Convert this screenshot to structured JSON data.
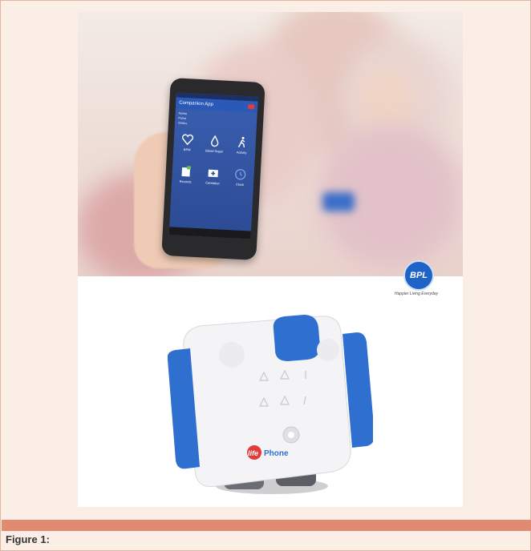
{
  "figure": {
    "caption": "Figure 1:"
  },
  "phone_app": {
    "title": "Companion App",
    "vitals": [
      "Name",
      "Pulse",
      "Status"
    ],
    "tiles_row1": [
      "BPM",
      "Blood Sugar",
      "Activity"
    ],
    "tiles_row2": [
      "Records",
      "Caretaker",
      "Clock"
    ]
  },
  "brand": {
    "logo": "BPL",
    "tagline": "Happier Living Everyday"
  },
  "device": {
    "brand_text_1": "life",
    "brand_text_2": "Phone"
  },
  "colors": {
    "frame_bg": "#fbeee6",
    "caption_bar": "#e08a6f",
    "app_blue": "#2c4a94",
    "logo_blue": "#1e63c6"
  }
}
